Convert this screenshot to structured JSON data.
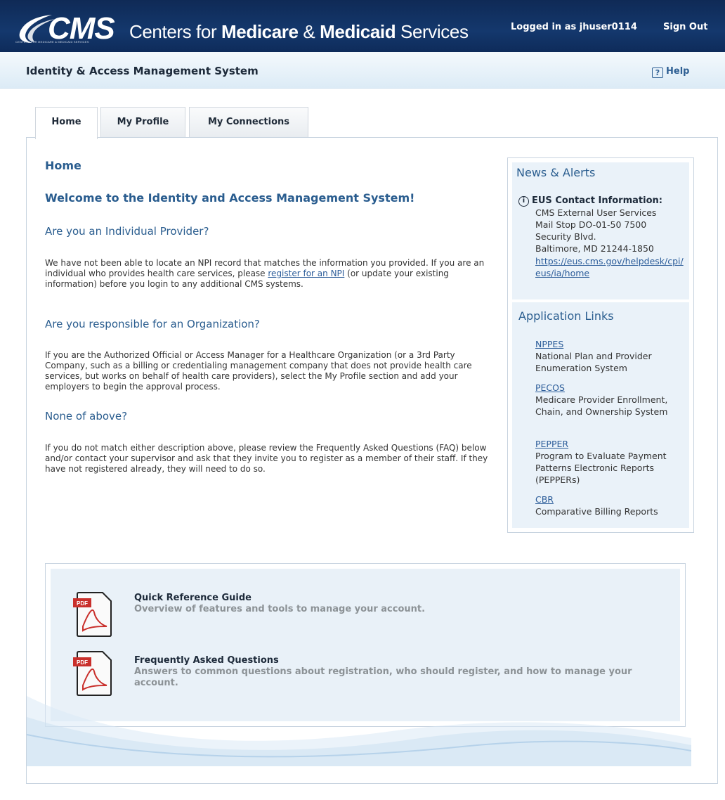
{
  "header": {
    "logo_text": "CMS",
    "logo_subtext": "CENTERS FOR MEDICARE & MEDICAID SERVICES",
    "org_name_prefix": "Centers for ",
    "org_name_bold1": "Medicare",
    "org_name_mid": " & ",
    "org_name_bold2": "Medicaid",
    "org_name_suffix": " Services",
    "logged_in": "Logged in as jhuser0114",
    "sign_out": "Sign Out"
  },
  "system_bar": {
    "title": "Identity & Access Management System",
    "help_icon": "?",
    "help_label": "Help"
  },
  "tabs": [
    {
      "label": "Home",
      "active": true
    },
    {
      "label": "My Profile",
      "active": false
    },
    {
      "label": "My Connections",
      "active": false
    }
  ],
  "main": {
    "heading": "Home",
    "welcome": "Welcome to the Identity and Access Management System!",
    "section1": {
      "title": "Are you an Individual Provider?",
      "text_before_link": "We have not been able to locate an NPI record that matches the information you provided. If you are an individual who provides health care services, please ",
      "link": "register for an NPI",
      "text_after_link": " (or update your existing information) before you login to any additional CMS systems."
    },
    "section2": {
      "title": "Are you responsible for an Organization?",
      "text": "If you are the Authorized Official or Access Manager for a Healthcare Organization (or a 3rd Party Company, such as a billing or credentialing management company that does not provide health care services, but works on behalf of health care providers), select the My Profile section and add your employers to begin the approval process."
    },
    "section3": {
      "title": "None of above?",
      "text": "If you do not match either description above, please review the Frequently Asked Questions (FAQ) below and/or contact your supervisor and ask that they invite you to register as a member of their staff. If they have not registered already, they will need to do so."
    }
  },
  "sidebar": {
    "news_title": "News & Alerts",
    "info_icon": "i",
    "eus_title": "EUS Contact Information:",
    "eus_lines": [
      "CMS External User Services",
      "Mail Stop DO-01-50 7500",
      "Security Blvd.",
      "Baltimore, MD 21244-1850"
    ],
    "eus_url": "https://eus.cms.gov/helpdesk/cpi/eus/ia/home",
    "apps_title": "Application Links",
    "apps": [
      {
        "label": "NPPES",
        "desc": "National Plan and Provider Enumeration System"
      },
      {
        "label": "PECOS",
        "desc": "Medicare Provider Enrollment, Chain, and Ownership System"
      },
      {
        "label": "PEPPER",
        "desc": "Program to Evaluate Payment Patterns Electronic Reports (PEPPERs)"
      },
      {
        "label": "CBR",
        "desc": "Comparative Billing Reports"
      }
    ]
  },
  "resources": [
    {
      "icon": "pdf-icon",
      "icon_label": "PDF",
      "title": "Quick Reference Guide",
      "desc": "Overview of features and tools to manage your account."
    },
    {
      "icon": "pdf-icon",
      "icon_label": "PDF",
      "title": "Frequently Asked Questions",
      "desc": "Answers to common questions about registration, who should register, and how to manage your account."
    }
  ],
  "colors": {
    "banner": "#14386d",
    "heading_blue": "#2a5d8f",
    "link_blue": "#2b5c99",
    "panel_bg": "#eaf2f9"
  }
}
